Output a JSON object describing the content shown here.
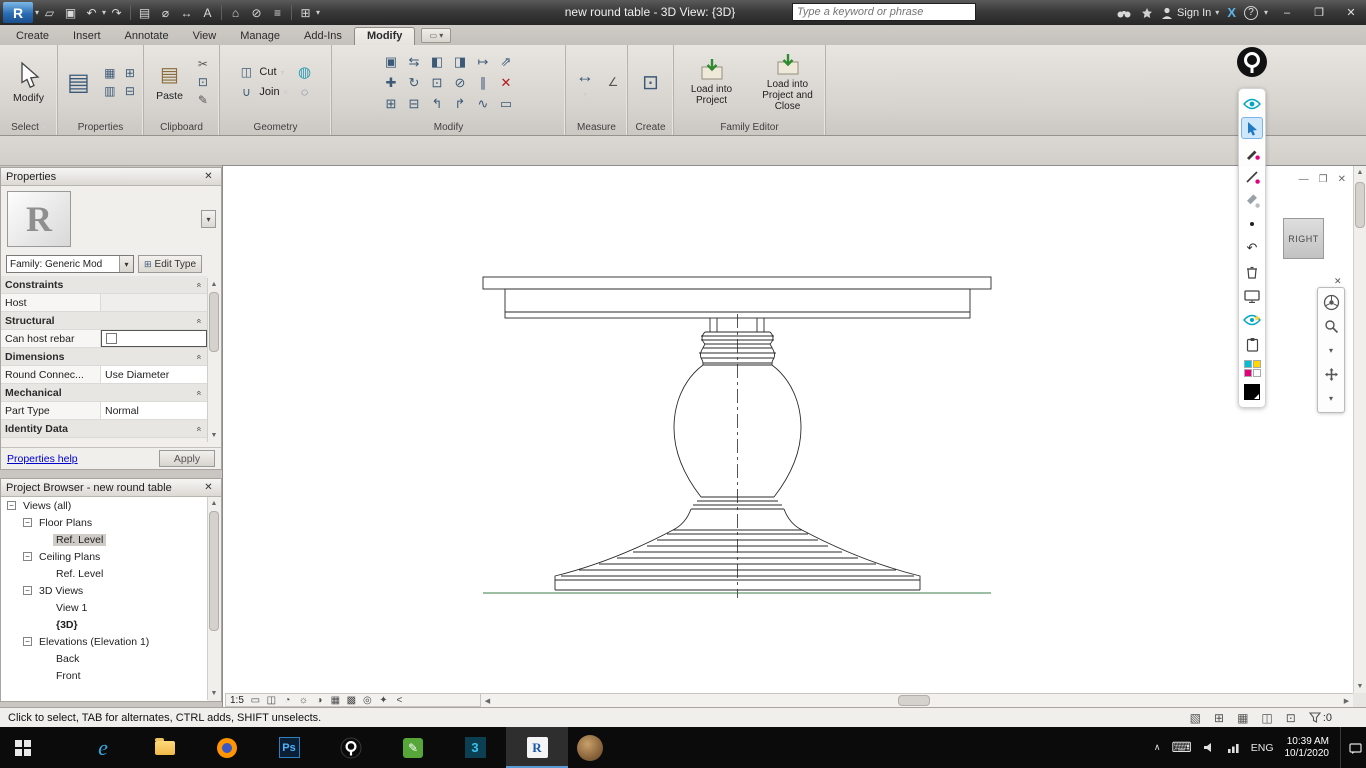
{
  "titlebar": {
    "title": "new round table - 3D View: {3D}",
    "search_placeholder": "Type a keyword or phrase",
    "sign_in_label": "Sign In",
    "qat_icons": [
      "▱",
      "▣",
      "↶",
      "↷",
      "▤",
      "⌀",
      "↔",
      "A",
      "⌂",
      "⊘",
      "≡",
      "⊞"
    ],
    "window_controls": {
      "minimize": "–",
      "restore": "❐",
      "close": "✕"
    }
  },
  "ribbon": {
    "tabs": [
      {
        "label": "Create"
      },
      {
        "label": "Insert"
      },
      {
        "label": "Annotate"
      },
      {
        "label": "View"
      },
      {
        "label": "Manage"
      },
      {
        "label": "Add-Ins"
      },
      {
        "label": "Modify"
      }
    ],
    "panels": {
      "select": {
        "label": "Select",
        "modify_button": "Modify"
      },
      "properties": {
        "label": "Properties",
        "button": "Properties"
      },
      "clipboard": {
        "label": "Clipboard",
        "paste_button": "Paste"
      },
      "geometry": {
        "label": "Geometry",
        "cut_button": "Cut",
        "join_button": "Join"
      },
      "modify": {
        "label": "Modify",
        "tools": [
          "▣",
          "⇆",
          "◧",
          "◨",
          "↦",
          "⇗",
          "✚",
          "↻",
          "⊡",
          "⊘",
          "∥",
          "✕",
          "⊞",
          "⊟",
          "↰",
          "↱",
          "∿",
          "▭"
        ]
      },
      "measure": {
        "label": "Measure"
      },
      "create": {
        "label": "Create"
      },
      "family_editor": {
        "label": "Family Editor",
        "load_into_project": "Load into Project",
        "load_into_project_and_close": "Load into Project and Close"
      }
    }
  },
  "properties_palette": {
    "title": "Properties",
    "preview_glyph": "R",
    "type_selector": "Family: Generic Mod",
    "edit_type_button": "Edit Type",
    "rows": [
      {
        "type": "section",
        "label": "Constraints"
      },
      {
        "type": "data",
        "name": "Host",
        "value": ""
      },
      {
        "type": "section",
        "label": "Structural"
      },
      {
        "type": "data",
        "name": "Can host rebar",
        "value": ""
      },
      {
        "type": "section",
        "label": "Dimensions"
      },
      {
        "type": "data",
        "name": "Round Connec...",
        "value": "Use Diameter"
      },
      {
        "type": "section",
        "label": "Mechanical"
      },
      {
        "type": "data",
        "name": "Part Type",
        "value": "Normal"
      },
      {
        "type": "section",
        "label": "Identity Data"
      }
    ],
    "help_link": "Properties help",
    "apply_button": "Apply"
  },
  "project_browser": {
    "title": "Project Browser - new round table",
    "tree": [
      {
        "label": "Views (all)",
        "level": 0
      },
      {
        "label": "Floor Plans",
        "level": 1
      },
      {
        "label": "Ref. Level",
        "level": 2,
        "selected": true
      },
      {
        "label": "Ceiling Plans",
        "level": 1
      },
      {
        "label": "Ref. Level",
        "level": 2
      },
      {
        "label": "3D Views",
        "level": 1
      },
      {
        "label": "View 1",
        "level": 2
      },
      {
        "label": "{3D}",
        "level": 2,
        "bold": true
      },
      {
        "label": "Elevations (Elevation 1)",
        "level": 1
      },
      {
        "label": "Back",
        "level": 2
      },
      {
        "label": "Front",
        "level": 2
      }
    ]
  },
  "canvas": {
    "viewcube_face": "RIGHT"
  },
  "view_controls": {
    "scale": "1:5",
    "icons": [
      "▭",
      "◫",
      "◔",
      "☼",
      "◑",
      "▦",
      "▩",
      "◎",
      "✦"
    ],
    "collapse": "<"
  },
  "status_bar": {
    "message": "Click to select, TAB for alternates, CTRL adds, SHIFT unselects.",
    "icons": [
      "▧",
      "⊞",
      "▦",
      "◫",
      "⊡"
    ],
    "filter_label": ":0"
  },
  "taskbar": {
    "language": "ENG",
    "time": "10:39 AM",
    "date": "10/1/2020"
  }
}
